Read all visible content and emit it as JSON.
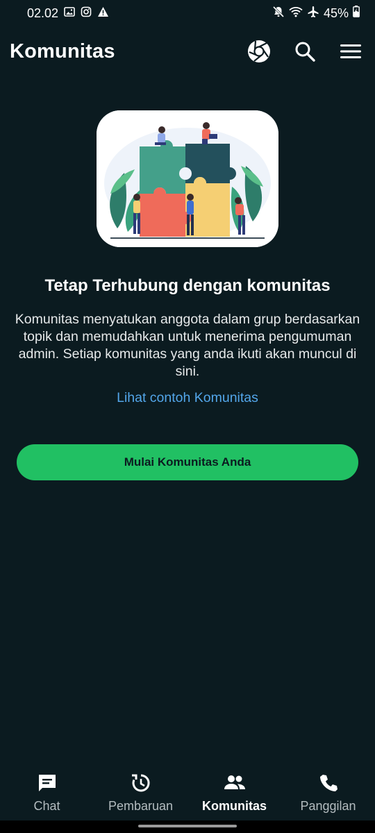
{
  "status": {
    "time": "02.02",
    "battery": "45%",
    "left_icons": [
      "gallery-icon",
      "instagram-icon",
      "warning-icon"
    ],
    "right_icons": [
      "mute-icon",
      "wifi-icon",
      "airplane-icon",
      "battery-charging-icon"
    ]
  },
  "header": {
    "title": "Komunitas",
    "actions": [
      "camera-shutter-icon",
      "search-icon",
      "menu-icon"
    ]
  },
  "main": {
    "heading": "Tetap Terhubung dengan komunitas",
    "description": "Komunitas menyatukan anggota dalam grup berdasarkan topik dan memudahkan untuk menerima pengumuman admin. Setiap komunitas yang anda ikuti akan muncul di sini.",
    "link": "Lihat contoh Komunitas",
    "cta": "Mulai Komunitas Anda"
  },
  "nav": {
    "items": [
      {
        "label": "Chat",
        "icon": "chat-icon",
        "active": false
      },
      {
        "label": "Pembaruan",
        "icon": "updates-icon",
        "active": false
      },
      {
        "label": "Komunitas",
        "icon": "communities-icon",
        "active": true
      },
      {
        "label": "Panggilan",
        "icon": "phone-icon",
        "active": false
      }
    ]
  },
  "colors": {
    "background": "#0b1b20",
    "accent": "#21c063",
    "link": "#53a6ea"
  }
}
